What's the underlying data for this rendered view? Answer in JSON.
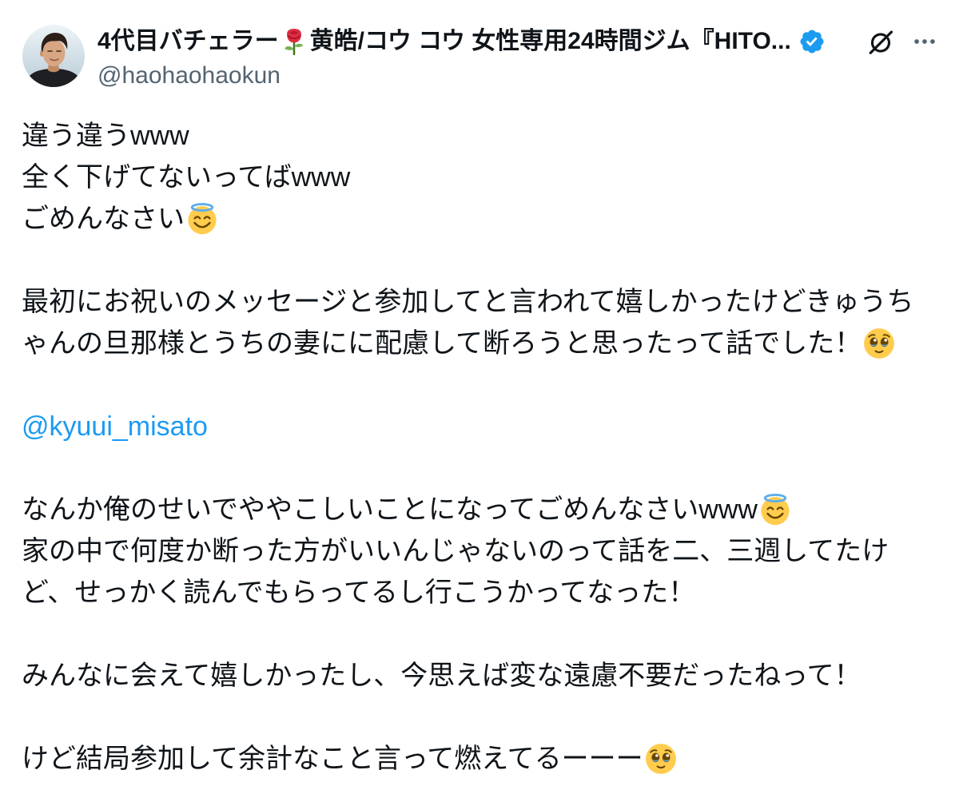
{
  "post": {
    "author": {
      "avatar": "profile-photo",
      "name_part_1": "4代目バチェラー",
      "name_emoji": "rose",
      "name_part_2": "黄皓/コウ コウ 女性専用24時間ジム『HITO...",
      "verified": true,
      "verified_icon": "verified-badge",
      "handle": "@haohaohaokun"
    },
    "header_actions": [
      {
        "icon": "grok-icon"
      },
      {
        "icon": "more-icon"
      }
    ],
    "body": {
      "paragraphs": [
        {
          "lines": [
            {
              "text": "違う違うwww"
            },
            {
              "text": "全く下げてないってばwww"
            },
            {
              "text": "ごめんなさい",
              "emoji": "smiling-face-with-halo"
            }
          ]
        },
        {
          "lines": [
            {
              "text": "最初にお祝いのメッセージと参加してと言われて嬉しかったけどきゅうち"
            },
            {
              "text": "ゃんの旦那様とうちの妻にに配慮して断ろうと思ったって話でした！",
              "emoji": "face-holding-back-tears"
            }
          ]
        },
        {
          "mention": "@kyuui_misato"
        },
        {
          "lines": [
            {
              "text": "なんか俺のせいでややこしいことになってごめんなさいwww",
              "emoji": "smiling-face-with-halo"
            },
            {
              "text": "家の中で何度か断った方がいいんじゃないのって話を二、三週してたけ"
            },
            {
              "text": "ど、せっかく読んでもらってるし行こうかってなった！"
            }
          ]
        },
        {
          "lines": [
            {
              "text": "みんなに会えて嬉しかったし、今思えば変な遠慮不要だったねって！"
            }
          ]
        },
        {
          "lines": [
            {
              "text": "けど結局参加して余計なこと言って燃えてるーーー",
              "emoji": "face-holding-back-tears"
            }
          ]
        }
      ]
    }
  },
  "colors": {
    "text": "#0F1419",
    "secondary_text": "#536471",
    "link": "#1D9BF0",
    "background": "#FFFFFF",
    "verified_badge": "#1D9BF0"
  }
}
